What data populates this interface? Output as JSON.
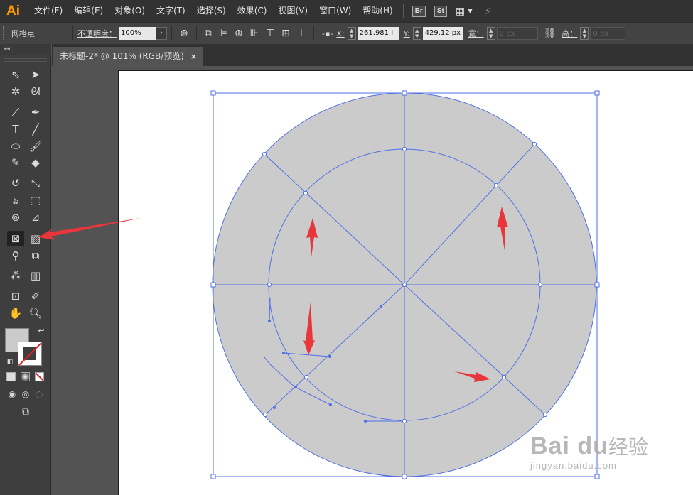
{
  "app": {
    "logo": "Ai"
  },
  "menu": [
    "文件(F)",
    "编辑(E)",
    "对象(O)",
    "文字(T)",
    "选择(S)",
    "效果(C)",
    "视图(V)",
    "窗口(W)",
    "帮助(H)"
  ],
  "menubar_icons": {
    "bridge": "Br",
    "stock": "St"
  },
  "control": {
    "selection_label": "网格点",
    "opacity_label": "不透明度：",
    "opacity_value": "100%",
    "x_label": "X:",
    "x_value": "261.981 I",
    "y_label": "Y:",
    "y_value": "429.12 px",
    "width_label": "宽：",
    "width_value": "0 px",
    "height_label": "高：",
    "height_value": "0 px"
  },
  "document_tab": {
    "title": "未标题-2* @ 101% (RGB/预览)",
    "close": "×"
  },
  "toolbar": {
    "collapse": "◂◂",
    "fill_color": "#cbcbcb",
    "active_tool": "mesh-tool"
  },
  "artwork": {
    "circle_fill": "#cbcbcb",
    "mesh_line_color": "#4f6fe8",
    "annotation_arrow_color": "#e8363b"
  },
  "watermark": {
    "logo": "Bai du",
    "cn": "经验",
    "url": "jingyan.baidu.com"
  }
}
